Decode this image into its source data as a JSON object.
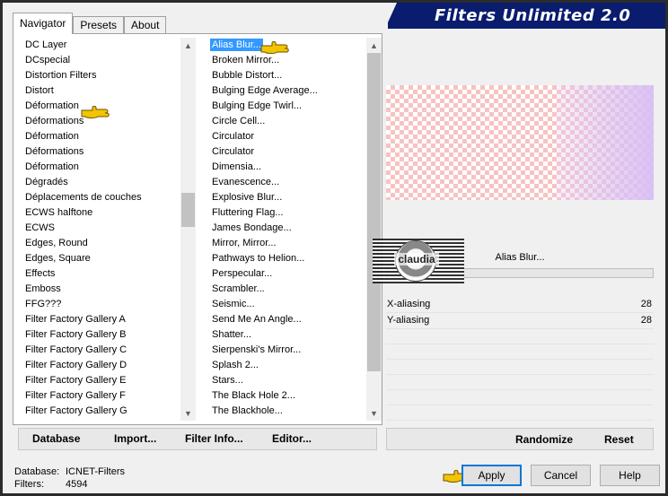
{
  "banner": {
    "title": "Filters Unlimited 2.0"
  },
  "tabs": [
    {
      "label": "Navigator",
      "active": true
    },
    {
      "label": "Presets",
      "active": false
    },
    {
      "label": "About",
      "active": false
    }
  ],
  "categories": [
    "DC Layer",
    "DCspecial",
    "Distortion Filters",
    "Distort",
    "Déformation",
    "Déformations",
    "Déformation",
    "Déformations",
    "Déformation",
    "Dégradés",
    "Déplacements de couches",
    "ECWS halftone",
    "ECWS",
    "Edges, Round",
    "Edges, Square",
    "Effects",
    "Emboss",
    "FFG???",
    "Filter Factory Gallery A",
    "Filter Factory Gallery B",
    "Filter Factory Gallery C",
    "Filter Factory Gallery D",
    "Filter Factory Gallery E",
    "Filter Factory Gallery F",
    "Filter Factory Gallery G"
  ],
  "filters": [
    "Alias Blur...",
    "Broken Mirror...",
    "Bubble Distort...",
    "Bulging Edge Average...",
    "Bulging Edge Twirl...",
    "Circle Cell...",
    "Circulator",
    "Circulator",
    "Dimensia...",
    "Evanescence...",
    "Explosive Blur...",
    "Fluttering Flag...",
    "James Bondage...",
    "Mirror, Mirror...",
    "Pathways to Helion...",
    "Perspecular...",
    "Scrambler...",
    "Seismic...",
    "Send Me An Angle...",
    "Shatter...",
    "Sierpenski's Mirror...",
    "Splash 2...",
    "Stars...",
    "The Black Hole 2...",
    "The Blackhole..."
  ],
  "toolbar": {
    "database": "Database",
    "import": "Import...",
    "filter_info": "Filter Info...",
    "editor": "Editor..."
  },
  "right_toolbar": {
    "randomize": "Randomize",
    "reset": "Reset"
  },
  "current_filter": "Alias Blur...",
  "watermark_text": "claudia",
  "params": [
    {
      "label": "X-aliasing",
      "value": "28"
    },
    {
      "label": "Y-aliasing",
      "value": "28"
    }
  ],
  "footer": {
    "database_label": "Database:",
    "database_value": "ICNET-Filters",
    "filters_label": "Filters:",
    "filters_value": "4594"
  },
  "dialog": {
    "apply": "Apply",
    "cancel": "Cancel",
    "help": "Help"
  },
  "colors": {
    "banner": "#0a1c6e",
    "selection": "#3399ff",
    "hand": "#f5c400"
  }
}
